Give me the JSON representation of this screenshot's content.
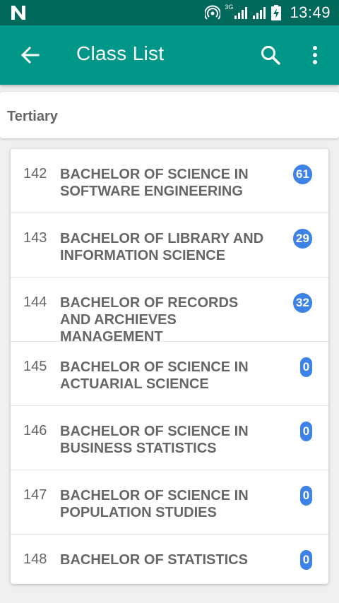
{
  "status_bar": {
    "time": "13:49",
    "network": "3G",
    "icons": [
      "n-icon",
      "hotspot-icon",
      "signal-icon",
      "signal-icon",
      "battery-charging-icon"
    ]
  },
  "app_bar": {
    "title": "Class List",
    "back_icon": "arrow-back-icon",
    "search_icon": "search-icon",
    "menu_icon": "more-vert-icon",
    "background": "#009688",
    "status_background": "#00695c"
  },
  "section": {
    "label": "Tertiary"
  },
  "classes": [
    {
      "id": "142",
      "name": "BACHELOR OF SCIENCE IN SOFTWARE ENGINEERING",
      "count": "61"
    },
    {
      "id": "143",
      "name": "BACHELOR OF LIBRARY AND INFORMATION SCIENCE",
      "count": "29"
    },
    {
      "id": "144",
      "name": "BACHELOR OF RECORDS AND ARCHIEVES MANAGEMENT",
      "count": "32"
    },
    {
      "id": "145",
      "name": "BACHELOR OF SCIENCE IN ACTUARIAL SCIENCE",
      "count": "0"
    },
    {
      "id": "146",
      "name": "BACHELOR OF SCIENCE IN BUSINESS STATISTICS",
      "count": "0"
    },
    {
      "id": "147",
      "name": "BACHELOR OF SCIENCE IN POPULATION STUDIES",
      "count": "0"
    },
    {
      "id": "148",
      "name": "BACHELOR OF STATISTICS",
      "count": "0"
    }
  ],
  "badge_color": "#3d82e6"
}
